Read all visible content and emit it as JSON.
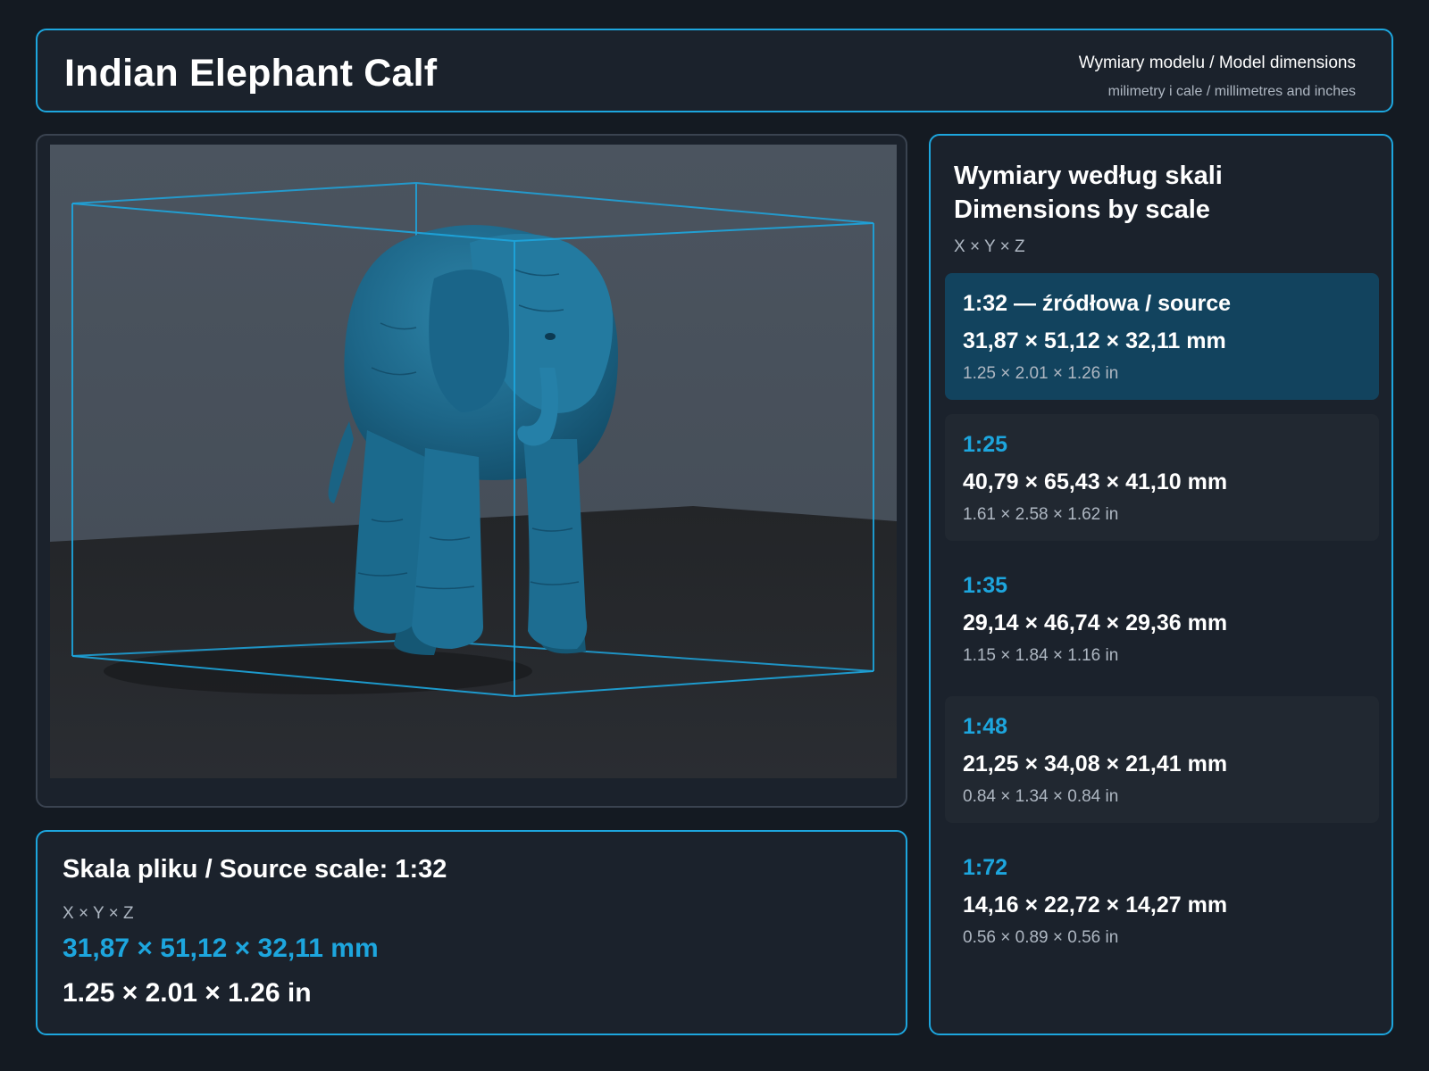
{
  "header": {
    "title": "Indian Elephant Calf",
    "subtitle_primary": "Wymiary modelu / Model dimensions",
    "subtitle_secondary": "milimetry i cale / millimetres and inches"
  },
  "viewer": {
    "subject": "elephant calf 3D model in bounding box",
    "colors": {
      "model": "#1f6f8e",
      "box": "#1da6de",
      "wall": "#4a535e",
      "floor": "#25272b"
    }
  },
  "source": {
    "label": "Skala pliku / Source scale: 1:32",
    "axes": "X × Y × Z",
    "mm": "31,87 × 51,12 × 32,11 mm",
    "inches": "1.25 × 2.01 × 1.26 in"
  },
  "scales": {
    "title_pl": "Wymiary według skali",
    "title_en": "Dimensions by scale",
    "axes": "X × Y × Z",
    "items": [
      {
        "ratio": "1:32  —  źródłowa / source",
        "mm": "31,87 × 51,12 × 32,11 mm",
        "inches": "1.25 × 2.01 × 1.26 in"
      },
      {
        "ratio": "1:25",
        "mm": "40,79 × 65,43 × 41,10 mm",
        "inches": "1.61 × 2.58 × 1.62 in"
      },
      {
        "ratio": "1:35",
        "mm": "29,14 × 46,74 × 29,36 mm",
        "inches": "1.15 × 1.84 × 1.16 in"
      },
      {
        "ratio": "1:48",
        "mm": "21,25 × 34,08 × 21,41 mm",
        "inches": "0.84 × 1.34 × 0.84 in"
      },
      {
        "ratio": "1:72",
        "mm": "14,16 × 22,72 × 14,27 mm",
        "inches": "0.56 × 0.89 × 0.56 in"
      }
    ]
  },
  "colors": {
    "accent": "#1da6de",
    "background": "#141a22",
    "panel": "#1b222c",
    "active_card": "#12435e",
    "muted_text": "#aeb7c2"
  }
}
